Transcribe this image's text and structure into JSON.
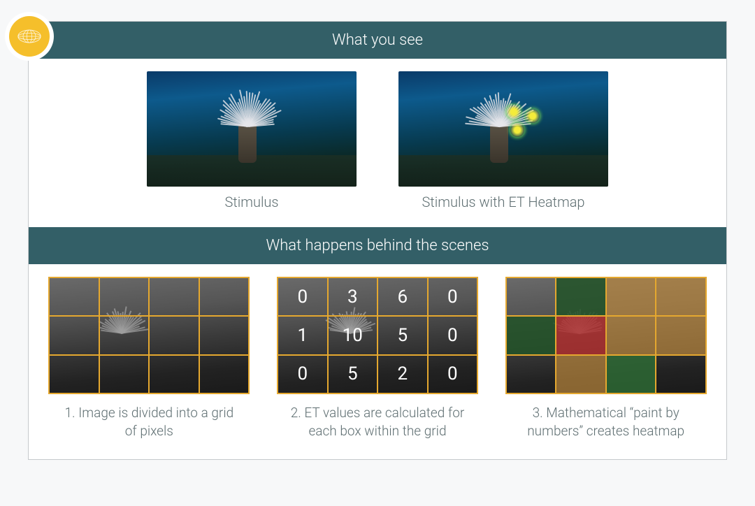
{
  "headers": {
    "top": "What you see",
    "bottom": "What happens behind the scenes"
  },
  "top_images": {
    "left_caption": "Stimulus",
    "right_caption": "Stimulus with ET Heatmap"
  },
  "steps": {
    "s1": "1. Image is divided into a grid of pixels",
    "s2": "2. ET values are calculated for each box within the grid",
    "s3": "3. Mathematical “paint by numbers” creates heatmap"
  },
  "chart_data": {
    "type": "heatmap",
    "title": "ET value grid",
    "rows": 3,
    "cols": 4,
    "values": [
      [
        0,
        3,
        6,
        0
      ],
      [
        1,
        10,
        5,
        0
      ],
      [
        0,
        5,
        2,
        0
      ]
    ],
    "color_map": {
      "0": "none",
      "low": "green",
      "mid": "amber",
      "high": "red"
    },
    "step3_overlays": [
      [
        "none",
        "darkgreen",
        "amber",
        "amber"
      ],
      [
        "darkgreen",
        "red",
        "amber",
        "amber"
      ],
      [
        "none",
        "amber",
        "green",
        "none"
      ]
    ]
  },
  "grid_labels": {
    "r0c0": "0",
    "r0c1": "3",
    "r0c2": "6",
    "r0c3": "0",
    "r1c0": "1",
    "r1c1": "10",
    "r1c2": "5",
    "r1c3": "0",
    "r2c0": "0",
    "r2c1": "5",
    "r2c2": "2",
    "r2c3": "0"
  }
}
